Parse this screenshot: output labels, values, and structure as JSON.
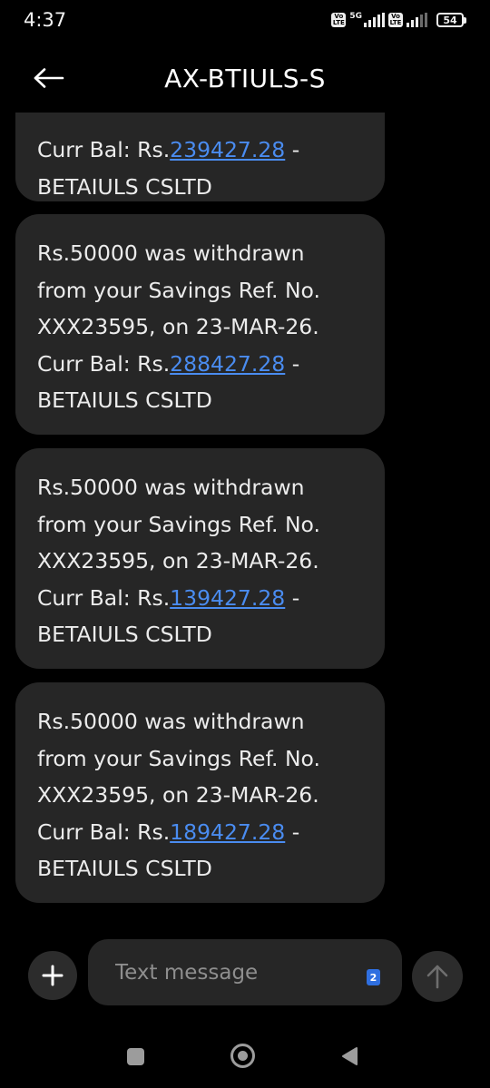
{
  "status_bar": {
    "time": "4:37",
    "sim1_badge": "Vo LTE",
    "network_label": "5G",
    "sim2_badge": "Vo LTE",
    "battery": "54"
  },
  "header": {
    "title": "AX-BTIULS-S",
    "back_icon": "arrow-left-icon"
  },
  "messages": [
    {
      "partial": true,
      "line_before_link": "Curr Bal: Rs.",
      "balance": "239427.28",
      "line_after_link": " -",
      "sender_line": "BETAIULS CSLTD"
    },
    {
      "line1": "Rs.50000 was withdrawn",
      "line2": "from your Savings Ref. No.",
      "line3": "XXX23595, on 23-MAR-26.",
      "line_before_link": "Curr Bal: Rs.",
      "balance": "288427.28",
      "line_after_link": " -",
      "sender_line": "BETAIULS CSLTD"
    },
    {
      "line1": "Rs.50000 was withdrawn",
      "line2": "from your Savings Ref. No.",
      "line3": "XXX23595, on 23-MAR-26.",
      "line_before_link": "Curr Bal: Rs.",
      "balance": "139427.28",
      "line_after_link": " -",
      "sender_line": "BETAIULS CSLTD"
    },
    {
      "line1": "Rs.50000 was withdrawn",
      "line2": "from your Savings Ref. No.",
      "line3": "XXX23595, on 23-MAR-26.",
      "line_before_link": "Curr Bal: Rs.",
      "balance": "189427.28",
      "line_after_link": " -",
      "sender_line": "BETAIULS CSLTD"
    }
  ],
  "composer": {
    "placeholder": "Text message",
    "value": "",
    "sim_badge": "2",
    "add_icon": "plus-icon",
    "send_icon": "arrow-up-icon"
  },
  "nav": {
    "recents_icon": "square-icon",
    "home_icon": "circle-icon",
    "back_icon": "triangle-back-icon"
  },
  "colors": {
    "background": "#000000",
    "bubble": "#262626",
    "link": "#4a8cf0",
    "text": "#ececec",
    "placeholder": "#8e8e8e",
    "sim_badge": "#2f6fe0"
  }
}
